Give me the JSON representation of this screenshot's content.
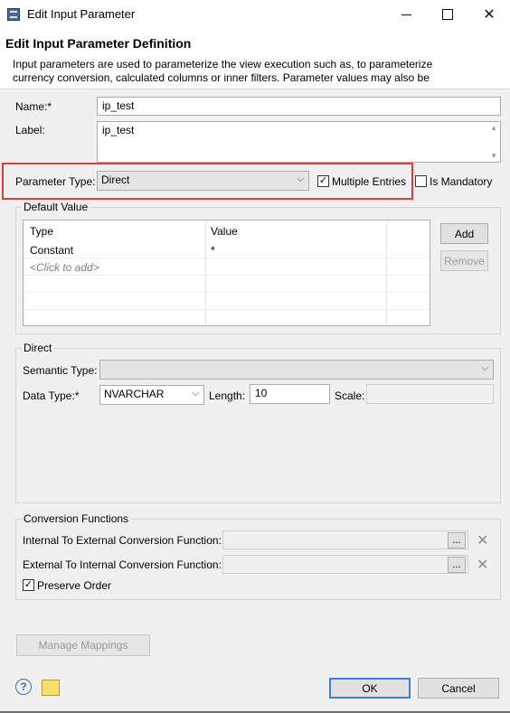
{
  "window": {
    "title": "Edit Input Parameter",
    "icon": "app-icon",
    "minimize": "minimize-icon",
    "maximize": "maximize-icon",
    "close": "✕"
  },
  "header": {
    "title": "Edit Input Parameter Definition",
    "description": "Input parameters are used to parameterize the view execution such as, to parameterize\ncurrency conversion, calculated columns or inner filters. Parameter values may also be"
  },
  "form": {
    "name_label": "Name:*",
    "name_value": "ip_test",
    "label_label": "Label:",
    "label_value": "ip_test",
    "parameter_type_label": "Parameter Type:",
    "parameter_type_value": "Direct",
    "multiple_entries_label": "Multiple Entries",
    "multiple_entries_checked": true,
    "is_mandatory_label": "Is Mandatory",
    "is_mandatory_checked": false
  },
  "default_value": {
    "title": "Default Value",
    "columns": [
      "Type",
      "Value"
    ],
    "rows": [
      {
        "type": "Constant",
        "value": "*"
      }
    ],
    "add_hint": "<Click to add>",
    "add_button": "Add",
    "remove_button": "Remove"
  },
  "direct": {
    "title": "Direct",
    "semantic_type_label": "Semantic Type:",
    "semantic_type_value": "",
    "data_type_label": "Data Type:*",
    "data_type_value": "NVARCHAR",
    "length_label": "Length:",
    "length_value": "10",
    "scale_label": "Scale:",
    "scale_value": ""
  },
  "conversion": {
    "title": "Conversion Functions",
    "int_to_ext_label": "Internal To External Conversion Function:",
    "ext_to_int_label": "External To Internal Conversion Function:",
    "browse_label": "...",
    "clear_icon": "✕",
    "preserve_order_label": "Preserve Order",
    "preserve_order_checked": true
  },
  "footer": {
    "manage_mappings": "Manage Mappings",
    "help_icon": "?",
    "note_icon": "note-icon",
    "ok": "OK",
    "cancel": "Cancel"
  },
  "glyphs": {
    "check": "✓",
    "chevron": "⌵"
  },
  "colors": {
    "highlight_border": "#e03c3c",
    "focus_border": "#7eb4ea",
    "default_button_border": "#3c7fd6"
  }
}
